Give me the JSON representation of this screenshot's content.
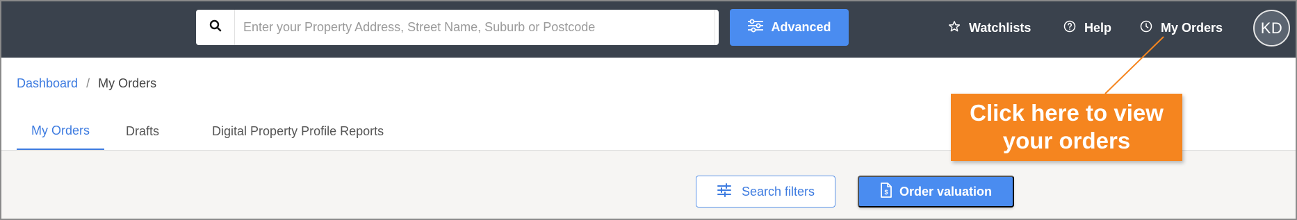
{
  "header": {
    "search": {
      "placeholder": "Enter your Property Address, Street Name, Suburb or Postcode",
      "value": "",
      "icon": "search-icon"
    },
    "advanced_label": "Advanced",
    "nav": {
      "watchlists": "Watchlists",
      "help": "Help",
      "my_orders": "My Orders"
    },
    "avatar_initials": "KD"
  },
  "breadcrumb": {
    "home": "Dashboard",
    "separator": "/",
    "current": "My Orders"
  },
  "tabs": [
    {
      "label": "My Orders",
      "active": true
    },
    {
      "label": "Drafts",
      "active": false
    },
    {
      "label": "Digital Property Profile Reports",
      "active": false
    }
  ],
  "actions": {
    "search_filters": "Search filters",
    "order_valuation": "Order valuation"
  },
  "annotation": {
    "line1": "Click here to view",
    "line2": "your orders"
  },
  "colors": {
    "topbar": "#3a424d",
    "primary": "#4a8cf0",
    "link": "#3d7be0",
    "callout": "#f5851f"
  }
}
